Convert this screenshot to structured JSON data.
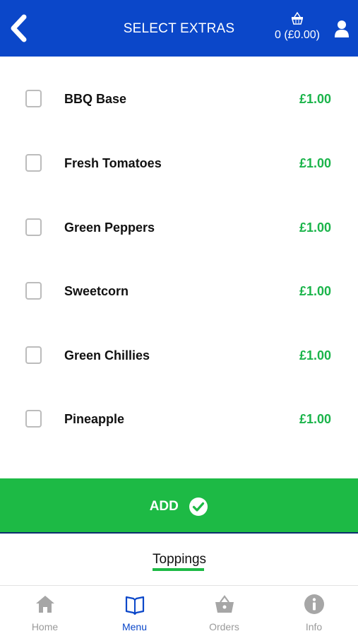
{
  "header": {
    "title": "SELECT EXTRAS",
    "basket_summary": "0 (£0.00)",
    "back_icon": "chevron-left-icon",
    "basket_icon": "basket-icon",
    "user_icon": "user-icon"
  },
  "extras": {
    "items": [
      {
        "name": "BBQ Base",
        "price": "£1.00",
        "checked": false
      },
      {
        "name": "Fresh Tomatoes",
        "price": "£1.00",
        "checked": false
      },
      {
        "name": "Green Peppers",
        "price": "£1.00",
        "checked": false
      },
      {
        "name": "Sweetcorn",
        "price": "£1.00",
        "checked": false
      },
      {
        "name": "Green Chillies",
        "price": "£1.00",
        "checked": false
      },
      {
        "name": "Pineapple",
        "price": "£1.00",
        "checked": false
      }
    ]
  },
  "add_button": {
    "label": "ADD",
    "icon": "check-circle-icon"
  },
  "category": {
    "active_tab": "Toppings"
  },
  "bottom_nav": {
    "items": [
      {
        "label": "Home",
        "icon": "home-icon",
        "active": false
      },
      {
        "label": "Menu",
        "icon": "menu-book-icon",
        "active": true
      },
      {
        "label": "Orders",
        "icon": "basket-icon",
        "active": false
      },
      {
        "label": "Info",
        "icon": "info-icon",
        "active": false
      }
    ]
  },
  "colors": {
    "header_bg": "#0b47c9",
    "accent_green": "#1dba45",
    "price_green": "#1ab44a",
    "nav_active": "#0b47c9",
    "nav_inactive": "#9a9a9a"
  }
}
